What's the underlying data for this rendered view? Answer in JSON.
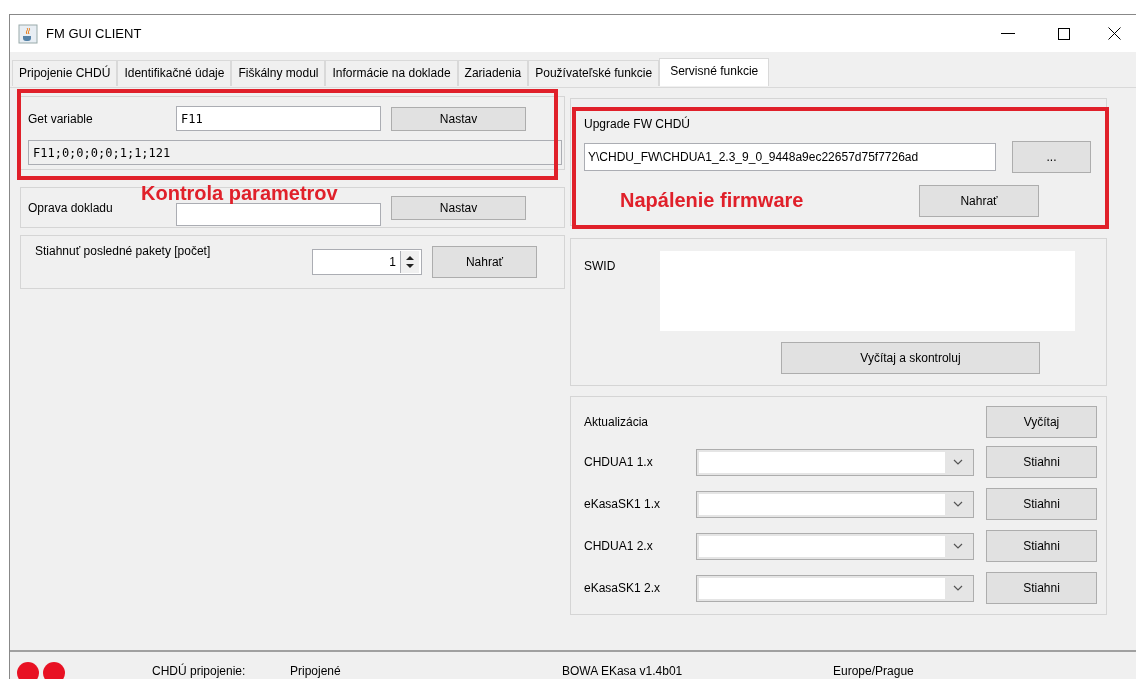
{
  "window": {
    "title": "FM GUI CLIENT"
  },
  "tabs": [
    {
      "label": "Pripojenie CHDÚ",
      "selected": false
    },
    {
      "label": "Identifikačné údaje",
      "selected": false
    },
    {
      "label": "Fiškálny modul",
      "selected": false
    },
    {
      "label": "Informácie na doklade",
      "selected": false
    },
    {
      "label": "Zariadenia",
      "selected": false
    },
    {
      "label": "Používateľské funkcie",
      "selected": false
    },
    {
      "label": "Servisné funkcie",
      "selected": true
    }
  ],
  "get_variable": {
    "label": "Get variable",
    "value": "F11",
    "button": "Nastav",
    "result": "F11;0;0;0;0;1;1;121"
  },
  "oprava_dokladu": {
    "label": "Oprava dokladu",
    "button": "Nastav"
  },
  "stiahnut_pakety": {
    "label": "Stiahnuť posledné pakety [počet]",
    "value": "1",
    "button": "Nahrať"
  },
  "upgrade_fw": {
    "label": "Upgrade FW CHDÚ",
    "path": "Y\\CHDU_FW\\CHDUA1_2.3_9_0_9448a9ec22657d75f7726ad",
    "browse_button": "...",
    "button": "Nahrať"
  },
  "swid": {
    "label": "SWID",
    "button": "Vyčítaj a skontroluj"
  },
  "aktualizacia": {
    "label": "Aktualizácia",
    "button": "Vyčítaj",
    "rows": [
      {
        "label": "CHDUA1 1.x",
        "button": "Stiahni"
      },
      {
        "label": "eKasaSK1 1.x",
        "button": "Stiahni"
      },
      {
        "label": "CHDUA1 2.x",
        "button": "Stiahni"
      },
      {
        "label": "eKasaSK1 2.x",
        "button": "Stiahni"
      }
    ]
  },
  "annotations": [
    {
      "text": "Kontrola parametrov"
    },
    {
      "text": "Napálenie firmware"
    }
  ],
  "status_bar": {
    "indicators": [
      {
        "color": "#e81123"
      },
      {
        "color": "#e81123"
      }
    ],
    "connection_label": "CHDÚ pripojenie:",
    "connection_value": "Pripojené",
    "version": "BOWA EKasa v1.4b01",
    "timezone": "Europe/Prague"
  }
}
